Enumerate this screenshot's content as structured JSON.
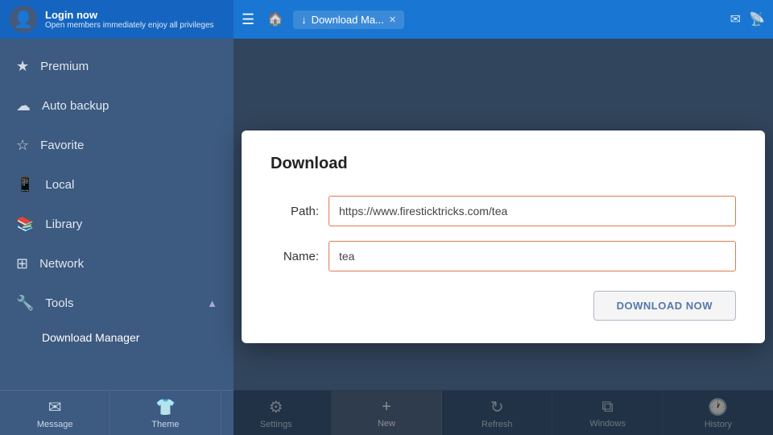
{
  "topbar": {
    "login_title": "Login now",
    "login_sub": "Open members immediately enjoy all privileges",
    "tab_label": "Download Ma...",
    "hamburger": "☰",
    "home": "🏠",
    "download_arrow": "↓"
  },
  "sidebar": {
    "items": [
      {
        "id": "premium",
        "label": "Premium",
        "icon": "★"
      },
      {
        "id": "auto-backup",
        "label": "Auto backup",
        "icon": "☁"
      },
      {
        "id": "favorite",
        "label": "Favorite",
        "icon": "☆"
      },
      {
        "id": "local",
        "label": "Local",
        "icon": "□"
      },
      {
        "id": "library",
        "label": "Library",
        "icon": "≡"
      },
      {
        "id": "network",
        "label": "Network",
        "icon": "⊞"
      },
      {
        "id": "tools",
        "label": "Tools",
        "icon": "🔧"
      }
    ],
    "sub_items": [
      {
        "id": "download-manager",
        "label": "Download Manager",
        "active": true
      }
    ]
  },
  "dialog": {
    "title": "Download",
    "path_label": "Path:",
    "path_value": "https://www.firesticktricks.com/tea",
    "name_label": "Name:",
    "name_value": "tea",
    "button_label": "DOWNLOAD NOW"
  },
  "bottombar": {
    "items": [
      {
        "id": "message",
        "label": "Message",
        "icon": "✉"
      },
      {
        "id": "theme",
        "label": "Theme",
        "icon": "👕"
      },
      {
        "id": "settings",
        "label": "Settings",
        "icon": "⚙"
      },
      {
        "id": "new",
        "label": "New",
        "icon": "+"
      },
      {
        "id": "refresh",
        "label": "Refresh",
        "icon": "↻"
      },
      {
        "id": "windows",
        "label": "Windows",
        "icon": "⧉"
      },
      {
        "id": "history",
        "label": "History",
        "icon": "🕐"
      }
    ]
  }
}
